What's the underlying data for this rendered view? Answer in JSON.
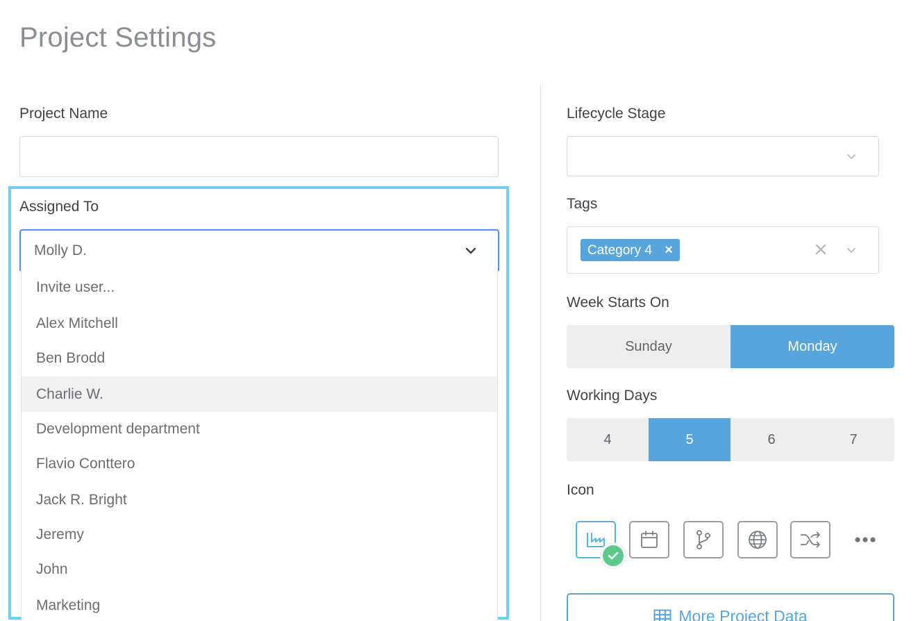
{
  "page": {
    "title": "Project Settings"
  },
  "fields": {
    "project_name": {
      "label": "Project Name",
      "value": ""
    },
    "assigned_to": {
      "label": "Assigned To",
      "selected": "Molly D.",
      "options": [
        "Invite user...",
        "Alex Mitchell",
        "Ben Brodd",
        "Charlie W.",
        "Development department",
        "Flavio Conttero",
        "Jack R. Bright",
        "Jeremy",
        "John",
        "Marketing"
      ],
      "hovered_option": "Charlie W."
    },
    "lifecycle_stage": {
      "label": "Lifecycle Stage",
      "value": ""
    },
    "tags": {
      "label": "Tags",
      "selected": [
        "Category 4"
      ],
      "remove_glyph": "×"
    },
    "week_starts_on": {
      "label": "Week Starts On",
      "options": [
        "Sunday",
        "Monday"
      ],
      "selected": "Monday"
    },
    "working_days": {
      "label": "Working Days",
      "options": [
        "4",
        "5",
        "6",
        "7"
      ],
      "selected": "5"
    },
    "icon": {
      "label": "Icon",
      "options": [
        "factory-icon",
        "calendar-icon",
        "git-branch-icon",
        "globe-icon",
        "shuffle-icon"
      ],
      "selected": "factory-icon",
      "more": "more-icon"
    }
  },
  "buttons": {
    "more_project_data": "More Project Data"
  },
  "colors": {
    "accent": "#56a6dd",
    "focus_border": "#4f8ff0",
    "highlight_outline": "#6dd1f5",
    "success": "#5bc98a"
  }
}
